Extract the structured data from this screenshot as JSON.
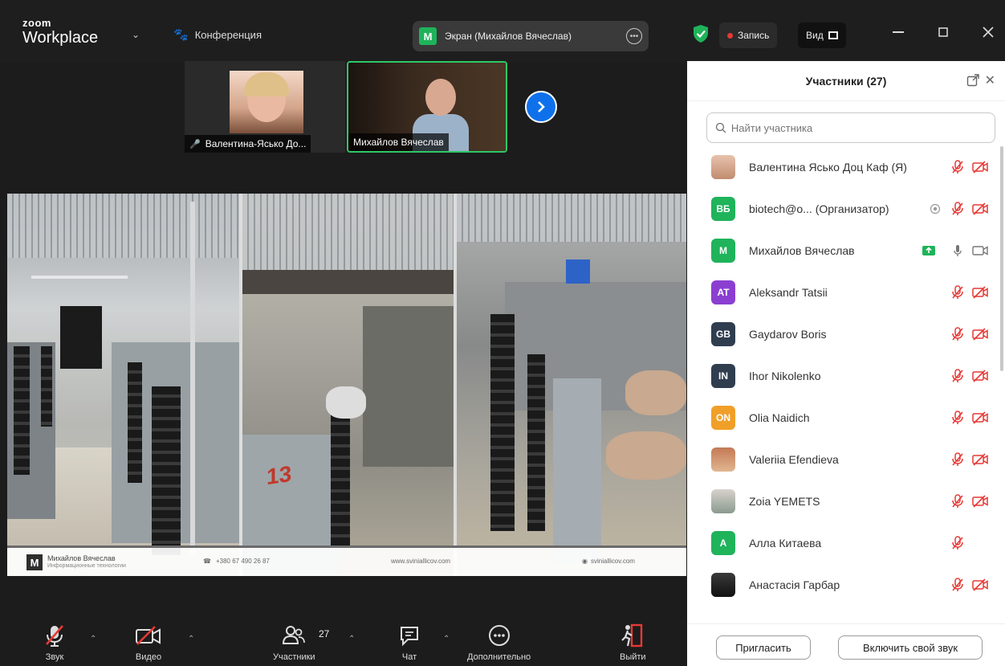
{
  "titlebar": {
    "logo_top": "zoom",
    "logo_bottom": "Workplace",
    "conference_label": "Конференция",
    "screen_avatar": "M",
    "screen_label": "Экран (Михайлов Вячеслав)",
    "record_label": "Запись",
    "view_label": "Вид"
  },
  "thumbnails": [
    {
      "name": "Валентина-Ясько До..."
    },
    {
      "name": "Михайлов Вячеслав"
    }
  ],
  "share": {
    "pen_number": "13",
    "footer_name": "Михайлов Вячеслав",
    "footer_sub": "Информационные технологии",
    "footer_phone": "+380 67 490 26 87",
    "footer_web1": "www.sviniallicov.com",
    "footer_web2": "sviniallicov.com"
  },
  "toolbar": {
    "audio": "Звук",
    "video": "Видео",
    "participants": "Участники",
    "participants_count": "27",
    "chat": "Чат",
    "more": "Дополнительно",
    "leave": "Выйти"
  },
  "side": {
    "title": "Участники (27)",
    "search_placeholder": "Найти участника",
    "participants": [
      {
        "name": "Валентина Ясько Доц Каф (Я)",
        "avatar": "",
        "color": "photo-1",
        "audio": "muted",
        "video": "off"
      },
      {
        "name": "biotech@o...  (Организатор)",
        "avatar": "ВБ",
        "color": "#1fb35a",
        "audio": "muted",
        "video": "off",
        "extra": "record-icon"
      },
      {
        "name": "Михайлов Вячеслав",
        "avatar": "M",
        "color": "#1fb35a",
        "audio": "on",
        "video": "on",
        "extra": "share-icon"
      },
      {
        "name": "Aleksandr Tatsii",
        "avatar": "AT",
        "color": "#8a3fd1",
        "audio": "muted",
        "video": "off"
      },
      {
        "name": "Gaydarov Boris",
        "avatar": "GB",
        "color": "#2f3d4f",
        "audio": "muted",
        "video": "off"
      },
      {
        "name": "Ihor Nikolenko",
        "avatar": "IN",
        "color": "#2f3d4f",
        "audio": "muted",
        "video": "off"
      },
      {
        "name": "Olia Naidich",
        "avatar": "ON",
        "color": "#f0a028",
        "audio": "muted",
        "video": "off"
      },
      {
        "name": "Valeriia Efendieva",
        "avatar": "",
        "color": "photo-2",
        "audio": "muted",
        "video": "off"
      },
      {
        "name": "Zoia YEMETS",
        "avatar": "",
        "color": "photo-3",
        "audio": "muted",
        "video": "off"
      },
      {
        "name": "Алла Китаева",
        "avatar": "A",
        "color": "#1fb35a",
        "audio": "muted",
        "video": "none"
      },
      {
        "name": "Анастасія Гарбар",
        "avatar": "",
        "color": "photo-4",
        "audio": "muted",
        "video": "off"
      }
    ],
    "invite_label": "Пригласить",
    "unmute_label": "Включить свой звук"
  },
  "colors": {
    "accent": "#0e71eb",
    "active_border": "#2ec866",
    "muted_red": "#e53935"
  }
}
